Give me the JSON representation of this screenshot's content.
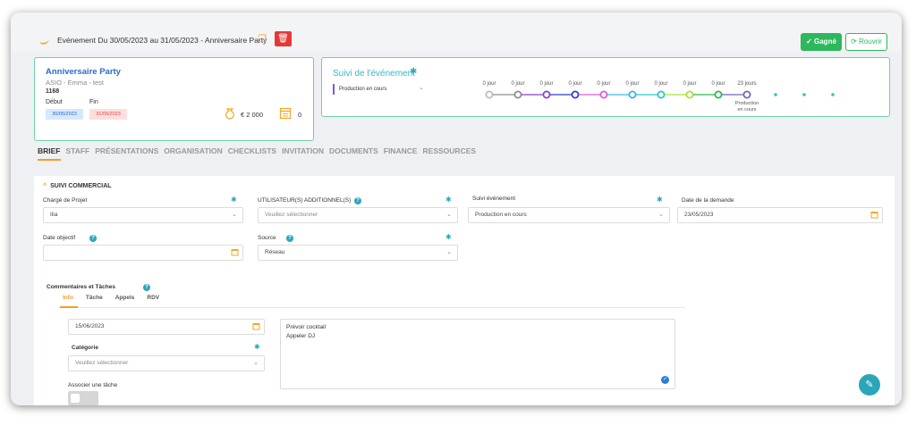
{
  "header": {
    "event_title": "Evénement Du 30/05/2023 au 31/05/2023 - Anniversaire Party",
    "won_label": "✓ Gagné",
    "reopen_label": "⟳ Rouvrir",
    "icons": [
      "moon-icon",
      "copy-icon",
      "trash-icon"
    ]
  },
  "event_card": {
    "title": "Anniversaire Party",
    "subtitle": "ASIO - Emma - test",
    "number": "1168",
    "start_label": "Début",
    "end_label": "Fin",
    "start_date": "30/05/2023",
    "end_date": "31/05/2023",
    "amount": "€ 2 000",
    "count": "0"
  },
  "tracking": {
    "title": "Suivi de l'événement",
    "status": "Production en cours",
    "steps": [
      {
        "label": "0 jour",
        "color": "#bdbdbd",
        "line": "#bdbdbd"
      },
      {
        "label": "0 jour",
        "color": "#8e8e8e",
        "line": "#8e8e8e"
      },
      {
        "label": "0 jour",
        "color": "#8a3fd1",
        "line": "#8a3fd1"
      },
      {
        "label": "0 jour",
        "color": "#2d3fd1",
        "line": "#2d3fd1"
      },
      {
        "label": "0 jour",
        "color": "#e05ad1",
        "line": "#e05ad1"
      },
      {
        "label": "0 jour",
        "color": "#3ab4e8",
        "line": "#3ab4e8"
      },
      {
        "label": "0 jour",
        "color": "#2ec4c4",
        "line": "#2ec4c4"
      },
      {
        "label": "0 jour",
        "color": "#a6e03a",
        "line": "#a6e03a"
      },
      {
        "label": "0 jour",
        "color": "#2eb84a",
        "line": "#2eb84a"
      },
      {
        "label": "23 jours",
        "color": "#6b6bb8",
        "line": "#6b6bb8"
      }
    ],
    "current_label_1": "Production",
    "current_label_2": "en cours",
    "dot_color": "#2ec4c4"
  },
  "tabs": [
    {
      "label": "BRIEF",
      "active": true
    },
    {
      "label": "STAFF"
    },
    {
      "label": "PRÉSENTATIONS"
    },
    {
      "label": "ORGANISATION"
    },
    {
      "label": "CHECKLISTS"
    },
    {
      "label": "INVITATION"
    },
    {
      "label": "DOCUMENTS"
    },
    {
      "label": "FINANCE"
    },
    {
      "label": "RESSOURCES"
    }
  ],
  "section": {
    "title": "SUIVI COMMERCIAL",
    "project_manager_label": "Chargé de Projet",
    "project_manager_value": "Ilia",
    "additional_users_label": "UTILISATEUR(S) ADDITIONNEL(S)",
    "additional_users_placeholder": "Veuillez sélectionner",
    "tracking_label": "Suivi événement",
    "tracking_value": "Production en cours",
    "request_date_label": "Date de la demande",
    "request_date_value": "23/05/2023",
    "target_date_label": "Date objectif",
    "target_date_value": "",
    "source_label": "Source",
    "source_value": "Réseau"
  },
  "comments": {
    "title": "Commentaires et Tâches",
    "subtabs": [
      "Info",
      "Tâche",
      "Appels",
      "RDV"
    ],
    "date_value": "15/06/2023",
    "category_label": "Catégorie",
    "category_placeholder": "Veuillez sélectionner",
    "note_line_1": "Prévoir cocktail",
    "note_line_2": "Appeler DJ",
    "assign_task_label": "Associer une tâche"
  },
  "colors": {
    "accent_green": "#2eb85c",
    "accent_teal": "#2aa6b8",
    "accent_orange": "#f59c24",
    "delete_red": "#e53935"
  }
}
